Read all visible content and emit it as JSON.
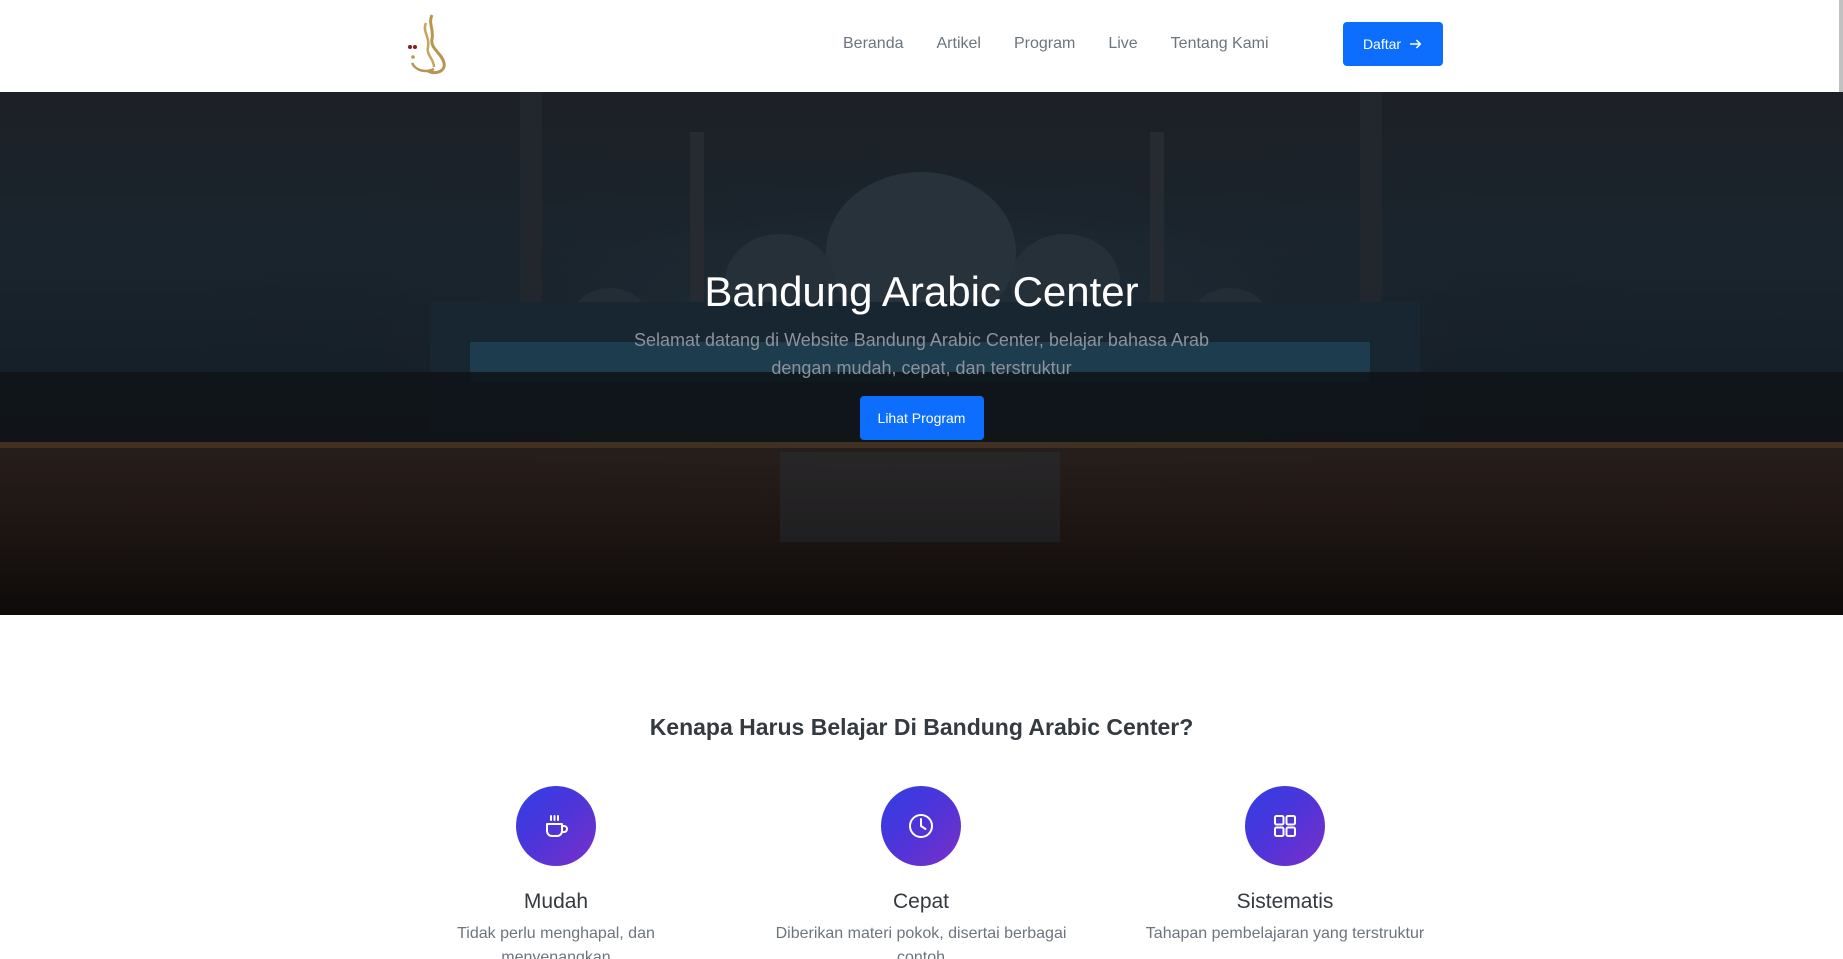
{
  "nav": {
    "logo_icon": "arabic-calligraphy-logo",
    "links": [
      "Beranda",
      "Artikel",
      "Program",
      "Live",
      "Tentang Kami"
    ],
    "cta_label": "Daftar",
    "cta_icon": "arrow-right-icon"
  },
  "hero": {
    "title": "Bandung Arabic Center",
    "subtitle": "Selamat datang di Website Bandung Arabic Center, belajar bahasa Arab dengan mudah, cepat, dan terstruktur",
    "button_label": "Lihat Program"
  },
  "features": {
    "title": "Kenapa Harus Belajar Di Bandung Arabic Center?",
    "items": [
      {
        "icon": "coffee-cup-icon",
        "name": "Mudah",
        "desc": "Tidak perlu menghapal, dan menyenangkan"
      },
      {
        "icon": "clock-icon",
        "name": "Cepat",
        "desc": "Diberikan materi pokok, disertai berbagai contoh"
      },
      {
        "icon": "grid-icon",
        "name": "Sistematis",
        "desc": "Tahapan pembelajaran yang terstruktur"
      }
    ]
  },
  "colors": {
    "primary": "#0d6efd",
    "icon_gradient_start": "#2f3fe6",
    "icon_gradient_end": "#7b2fc9"
  }
}
